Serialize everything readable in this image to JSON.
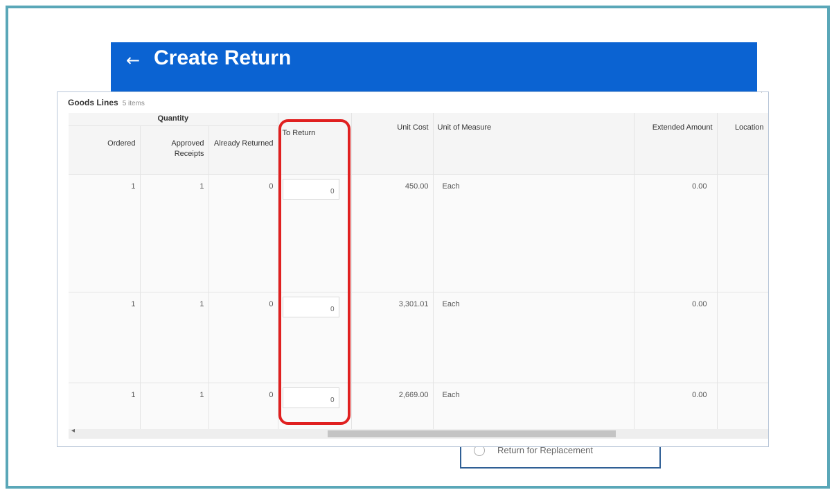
{
  "header": {
    "title": "Create Return",
    "back_icon": "arrow-left-icon"
  },
  "background": {
    "option_label": "Return for Replacement"
  },
  "panel": {
    "title": "Goods Lines",
    "count": "5 items"
  },
  "table": {
    "group_header": "Quantity",
    "columns": {
      "ordered": "Ordered",
      "approved_receipts": "Approved Receipts",
      "already_returned": "Already Returned",
      "to_return": "To Return",
      "unit_cost": "Unit Cost",
      "unit_of_measure": "Unit of Measure",
      "extended_amount": "Extended Amount",
      "location": "Location"
    },
    "rows": [
      {
        "ordered": "1",
        "approved": "1",
        "returned": "0",
        "to_return": "0",
        "unit_cost": "450.00",
        "uom": "Each",
        "extended": "0.00",
        "location": ""
      },
      {
        "ordered": "1",
        "approved": "1",
        "returned": "0",
        "to_return": "0",
        "unit_cost": "3,301.01",
        "uom": "Each",
        "extended": "0.00",
        "location": ""
      },
      {
        "ordered": "1",
        "approved": "1",
        "returned": "0",
        "to_return": "0",
        "unit_cost": "2,669.00",
        "uom": "Each",
        "extended": "0.00",
        "location": ""
      }
    ]
  },
  "colors": {
    "header_bg": "#0b63d2",
    "highlight": "#e02020",
    "frame": "#5aa7b8"
  }
}
